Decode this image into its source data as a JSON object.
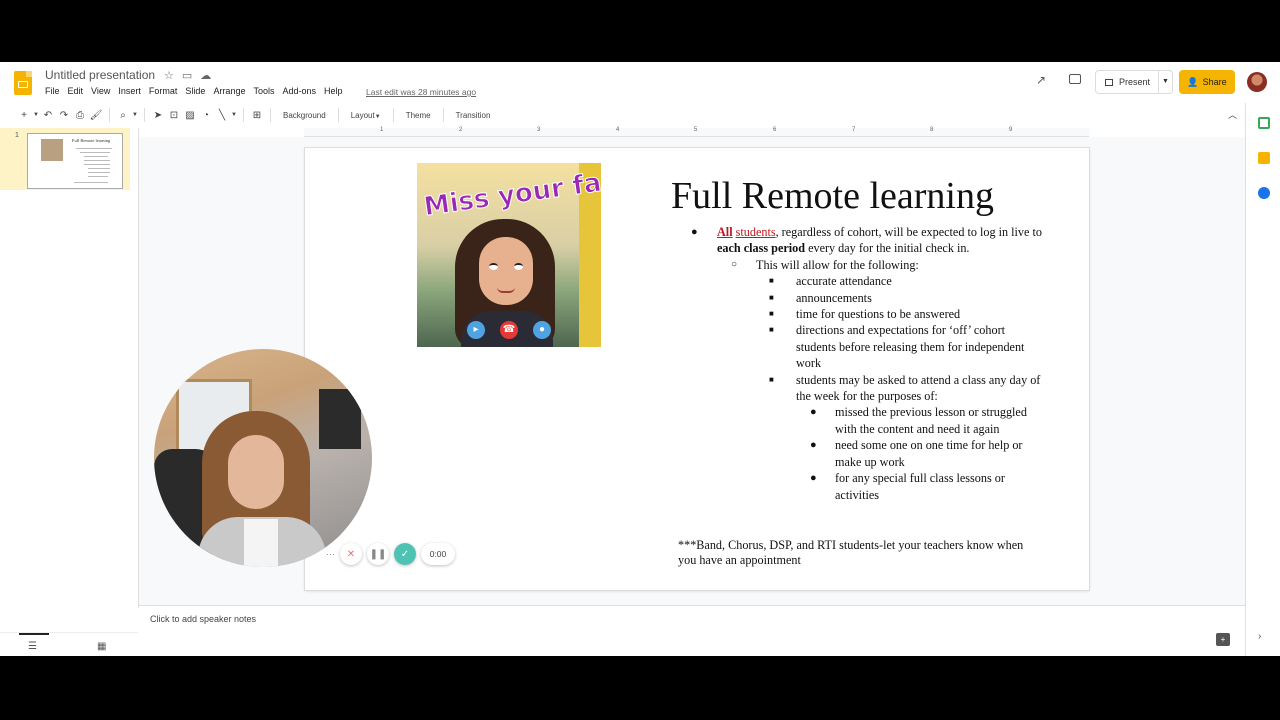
{
  "app": {
    "doc_title": "Untitled presentation",
    "menu": [
      "File",
      "Edit",
      "View",
      "Insert",
      "Format",
      "Slide",
      "Arrange",
      "Tools",
      "Add-ons",
      "Help"
    ],
    "last_edit": "Last edit was 28 minutes ago",
    "present_label": "Present",
    "share_label": "Share",
    "accent_color": "#f4b400"
  },
  "toolbar": {
    "background_label": "Background",
    "layout_label": "Layout",
    "theme_label": "Theme",
    "transition_label": "Transition"
  },
  "ruler": [
    "1",
    "2",
    "3",
    "4",
    "5",
    "6",
    "7",
    "8",
    "9"
  ],
  "filmstrip": {
    "slide_number": "1",
    "thumb_title": "Full Remote learning"
  },
  "slide": {
    "title": "Full Remote learning",
    "bitmoji_text": "Miss your face!",
    "bullet1": {
      "highlight_all": "All",
      "highlight_students": "students",
      "text_a": ", regardless of cohort, will be expected to log in live to ",
      "bold": "each class period",
      "text_b": " every day for the initial check in."
    },
    "sub1": "This will allow for the following:",
    "items": [
      "accurate attendance",
      "announcements",
      "time for questions to be answered",
      "directions and expectations for ‘off’ cohort students before releasing them for independent work",
      "students may be asked to attend a class any day of the week for the purposes of:"
    ],
    "purposes": [
      "missed the previous lesson or struggled with the content and need it again",
      "need some one on one time for help or make up work",
      "for any special full class lessons or activities"
    ],
    "footnote": "***Band, Chorus, DSP, and RTI students-let your teachers know when you have an appointment"
  },
  "recorder": {
    "time": "0:00",
    "more": "···"
  },
  "notes_placeholder": "Click to add speaker notes"
}
